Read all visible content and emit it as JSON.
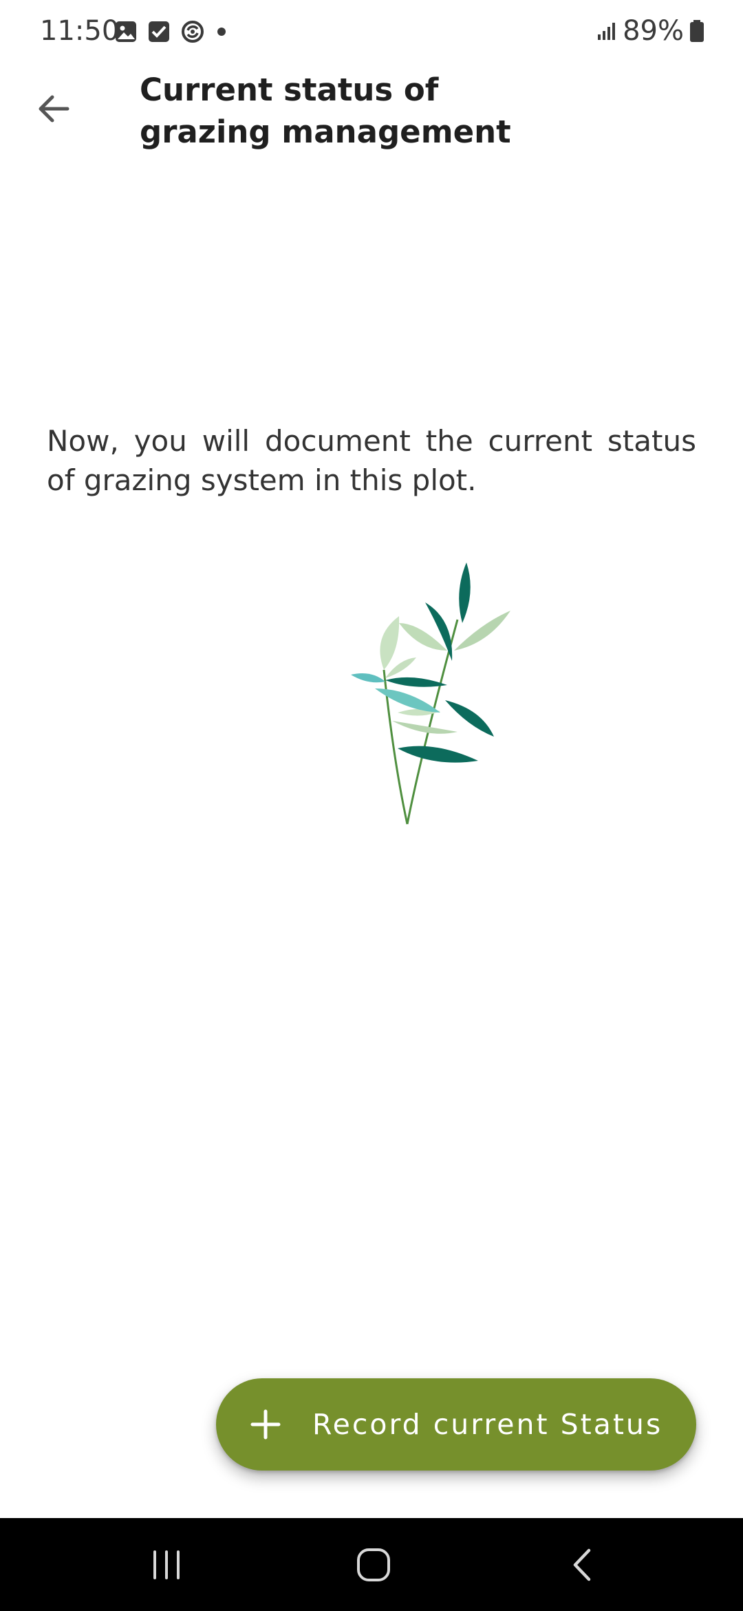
{
  "status_bar": {
    "time": "11:50",
    "battery": "89%",
    "icons": [
      "image-icon",
      "checkbox-icon",
      "sync-icon",
      "dot-icon",
      "signal-icon",
      "battery-icon"
    ]
  },
  "app_bar": {
    "title": "Current status of grazing management",
    "back_icon": "arrow-left-icon"
  },
  "main": {
    "intro_text": "Now, you will document the current status of grazing system in this plot.",
    "illustration": "plant-leaves-illustration"
  },
  "fab": {
    "label": "Record current Status",
    "icon": "plus-icon",
    "color": "#76902c"
  },
  "nav_bar": {
    "buttons": [
      "recent-apps-icon",
      "home-icon",
      "back-icon"
    ]
  },
  "colors": {
    "leaf_dark": "#0c6b5c",
    "leaf_light": "#b7d5b0",
    "leaf_teal": "#5fbfbf",
    "stem": "#4f8f3f"
  }
}
